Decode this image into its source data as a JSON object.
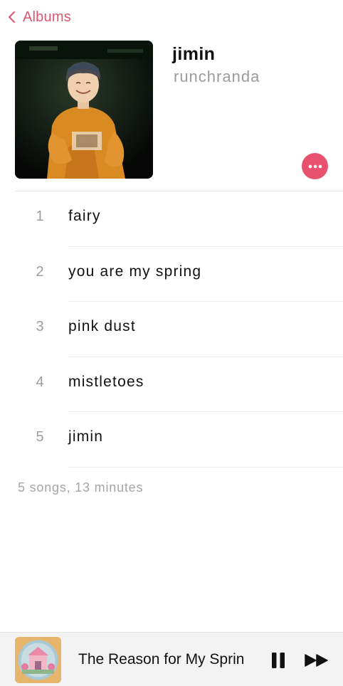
{
  "nav": {
    "back_label": "Albums"
  },
  "album": {
    "title": "jimin",
    "artist": "runchranda",
    "artwork_icon": "album-artwork-photo",
    "more_icon": "ellipsis-icon"
  },
  "tracks": [
    {
      "number": "1",
      "title": "fairy"
    },
    {
      "number": "2",
      "title": "you are my spring"
    },
    {
      "number": "3",
      "title": "pink dust"
    },
    {
      "number": "4",
      "title": "mistletoes"
    },
    {
      "number": "5",
      "title": "jimin"
    }
  ],
  "summary": "5 songs, 13 minutes",
  "now_playing": {
    "title": "The Reason for My Spring",
    "pause_icon": "pause-icon",
    "forward_icon": "fast-forward-icon"
  },
  "colors": {
    "accent": "#e8526f",
    "secondary_text": "#9b9b9b",
    "divider": "#ebebeb"
  }
}
